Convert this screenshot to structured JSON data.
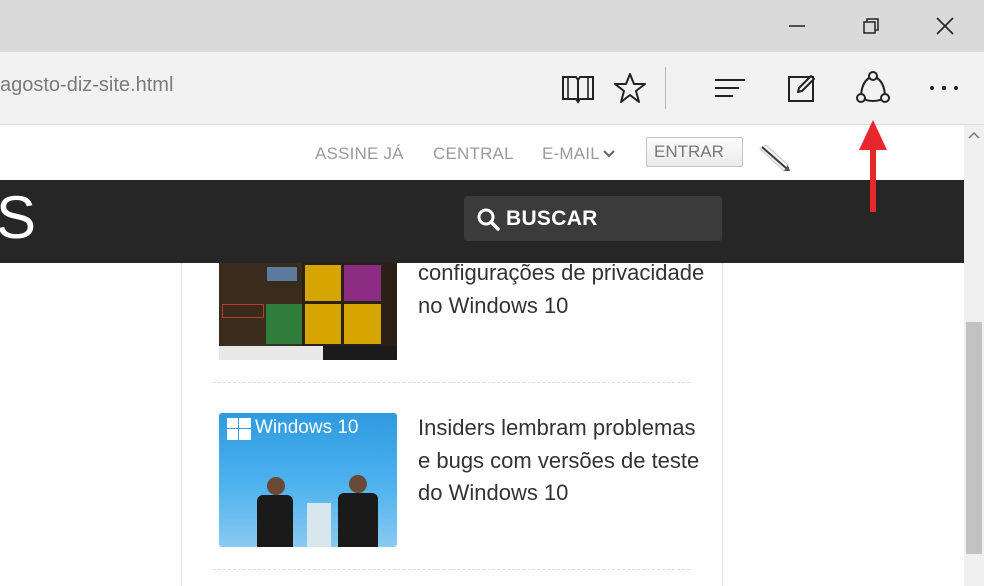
{
  "window": {
    "minimize_icon": "minimize-icon",
    "restore_icon": "restore-icon",
    "close_icon": "close-icon"
  },
  "toolbar": {
    "url_text": "agosto-diz-site.html",
    "icons": [
      "reading-view-icon",
      "favorites-star-icon",
      "hub-icon",
      "web-note-icon",
      "share-icon",
      "more-icon"
    ]
  },
  "annotation": {
    "color": "#e8262b"
  },
  "site": {
    "top_links": [
      "ASSINE JÁ",
      "CENTRAL",
      "E-MAIL"
    ],
    "login_label": "ENTRAR",
    "logo_letter": "S",
    "search_label": "BUSCAR"
  },
  "articles": [
    {
      "title": "configurações de privacidade no Windows 10"
    },
    {
      "title": "Insiders lembram problemas e bugs com versões de teste do Windows 10",
      "image_caption": "Windows 10"
    }
  ],
  "colors": {
    "navbar": "#262626",
    "titlebar": "#dadada",
    "toolbar": "#f2f2f2"
  }
}
